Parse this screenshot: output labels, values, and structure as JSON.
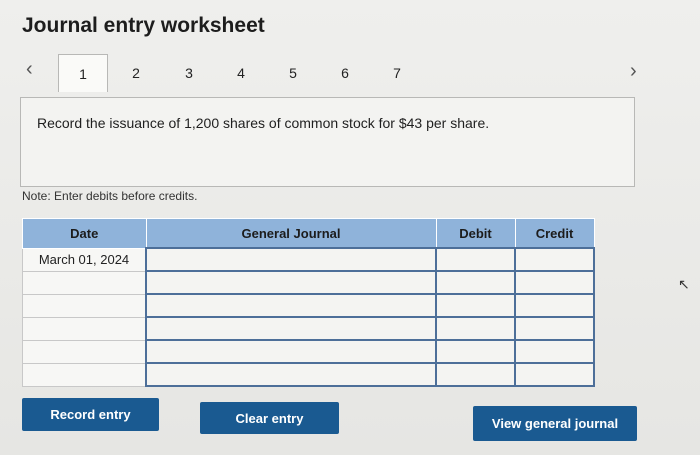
{
  "worksheet": {
    "title": "Journal entry worksheet"
  },
  "tabs": [
    "1",
    "2",
    "3",
    "4",
    "5",
    "6",
    "7"
  ],
  "active_tab": "1",
  "question": {
    "text": "Record the issuance of 1,200 shares of common stock for $43 per share."
  },
  "note": "Note: Enter debits before credits.",
  "table": {
    "headers": {
      "date": "Date",
      "journal": "General Journal",
      "debit": "Debit",
      "credit": "Credit"
    },
    "rows": [
      {
        "date": "March 01, 2024",
        "journal": "",
        "debit": "",
        "credit": ""
      },
      {
        "date": "",
        "journal": "",
        "debit": "",
        "credit": ""
      },
      {
        "date": "",
        "journal": "",
        "debit": "",
        "credit": ""
      },
      {
        "date": "",
        "journal": "",
        "debit": "",
        "credit": ""
      },
      {
        "date": "",
        "journal": "",
        "debit": "",
        "credit": ""
      },
      {
        "date": "",
        "journal": "",
        "debit": "",
        "credit": ""
      }
    ]
  },
  "buttons": {
    "record": "Record entry",
    "clear": "Clear entry",
    "view": "View general journal"
  },
  "icons": {
    "prev": "chevron-left-icon",
    "next": "chevron-right-icon"
  },
  "colors": {
    "header_bg": "#8fb3da",
    "button_bg": "#1a5a91",
    "input_border": "#4d6f99"
  }
}
